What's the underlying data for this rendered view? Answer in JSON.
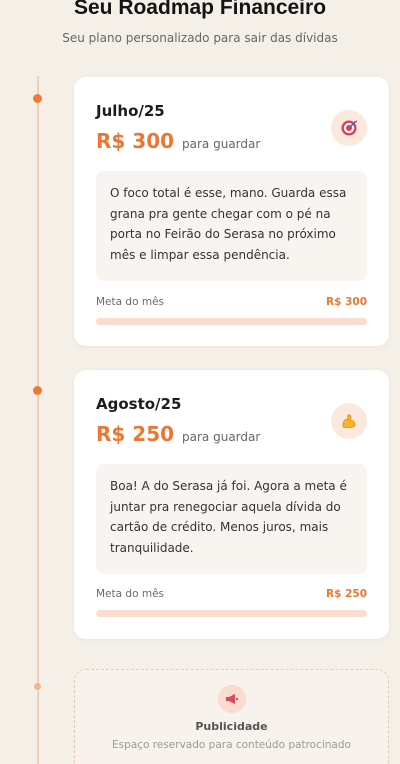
{
  "header": {
    "title": "Seu Roadmap Financeiro",
    "subtitle": "Seu plano personalizado para sair das dívidas"
  },
  "timeline": [
    {
      "month": "Julho/25",
      "amount": "R$ 300",
      "amount_suffix": "para guardar",
      "icon": "target-icon",
      "message": "O foco total é esse, mano. Guarda essa grana pra gente chegar com o pé na porta no Feirão do Serasa no próximo mês e limpar essa pendência.",
      "goal_label": "Meta do mês",
      "goal_value": "R$ 300",
      "progress_fraction": 0
    },
    {
      "month": "Agosto/25",
      "amount": "R$ 250",
      "amount_suffix": "para guardar",
      "icon": "flexed-biceps-icon",
      "message": "Boa! A do Serasa já foi. Agora a meta é juntar pra renegociar aquela dívida do cartão de crédito. Menos juros, mais tranquilidade.",
      "goal_label": "Meta do mês",
      "goal_value": "R$ 250",
      "progress_fraction": 0
    }
  ],
  "ad": {
    "icon": "megaphone-icon",
    "title": "Publicidade",
    "subtitle": "Espaço reservado para conteúdo patrocinado"
  },
  "colors": {
    "accent": "#ec7633",
    "timeline_line": "#f3cfb8",
    "progress_track": "#f9ded0",
    "background": "#f4f0e8"
  }
}
